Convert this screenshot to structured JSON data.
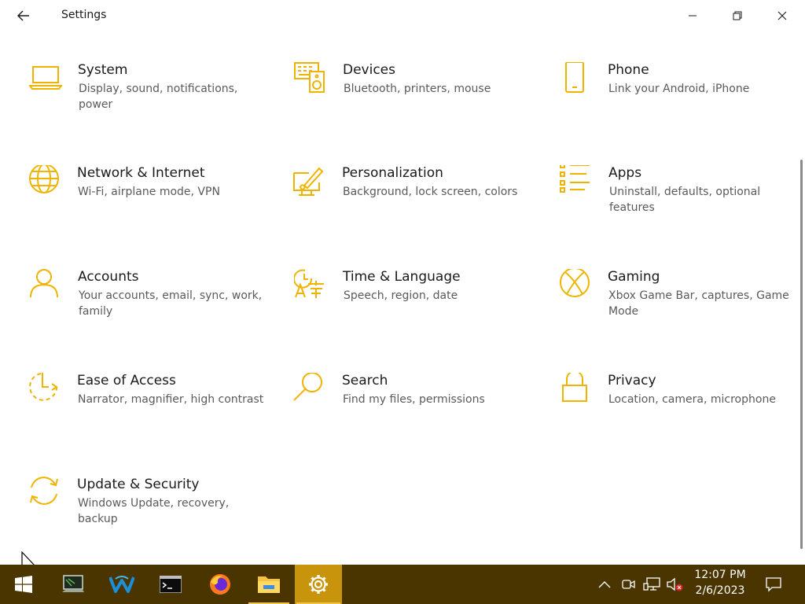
{
  "window": {
    "title": "Settings",
    "accent": "#F0B400"
  },
  "tiles": [
    {
      "title": "System",
      "desc": "Display, sound, notifications, power",
      "icon": "laptop-icon"
    },
    {
      "title": "Devices",
      "desc": "Bluetooth, printers, mouse",
      "icon": "devices-icon"
    },
    {
      "title": "Phone",
      "desc": "Link your Android, iPhone",
      "icon": "phone-icon"
    },
    {
      "title": "Network & Internet",
      "desc": "Wi-Fi, airplane mode, VPN",
      "icon": "globe-icon"
    },
    {
      "title": "Personalization",
      "desc": "Background, lock screen, colors",
      "icon": "paintbrush-icon"
    },
    {
      "title": "Apps",
      "desc": "Uninstall, defaults, optional features",
      "icon": "apps-list-icon"
    },
    {
      "title": "Accounts",
      "desc": "Your accounts, email, sync, work, family",
      "icon": "person-icon"
    },
    {
      "title": "Time & Language",
      "desc": "Speech, region, date",
      "icon": "time-language-icon"
    },
    {
      "title": "Gaming",
      "desc": "Xbox Game Bar, captures, Game Mode",
      "icon": "xbox-icon"
    },
    {
      "title": "Ease of Access",
      "desc": "Narrator, magnifier, high contrast",
      "icon": "ease-of-access-icon"
    },
    {
      "title": "Search",
      "desc": "Find my files, permissions",
      "icon": "search-icon"
    },
    {
      "title": "Privacy",
      "desc": "Location, camera, microphone",
      "icon": "lock-icon"
    },
    {
      "title": "Update & Security",
      "desc": "Windows Update, recovery, backup",
      "icon": "sync-arrows-icon"
    }
  ],
  "taskbar": {
    "background": "#4A3500",
    "active_color": "#C8940B",
    "items": [
      "start-icon",
      "terminal-app-icon",
      "wireshark-icon",
      "command-prompt-icon",
      "firefox-icon",
      "file-explorer-icon",
      "settings-gear-icon"
    ],
    "tray_icons": [
      "chevron-up-icon",
      "meet-now-icon",
      "network-icon",
      "volume-muted-icon"
    ],
    "clock": {
      "time": "12:07 PM",
      "date": "2/6/2023"
    }
  }
}
